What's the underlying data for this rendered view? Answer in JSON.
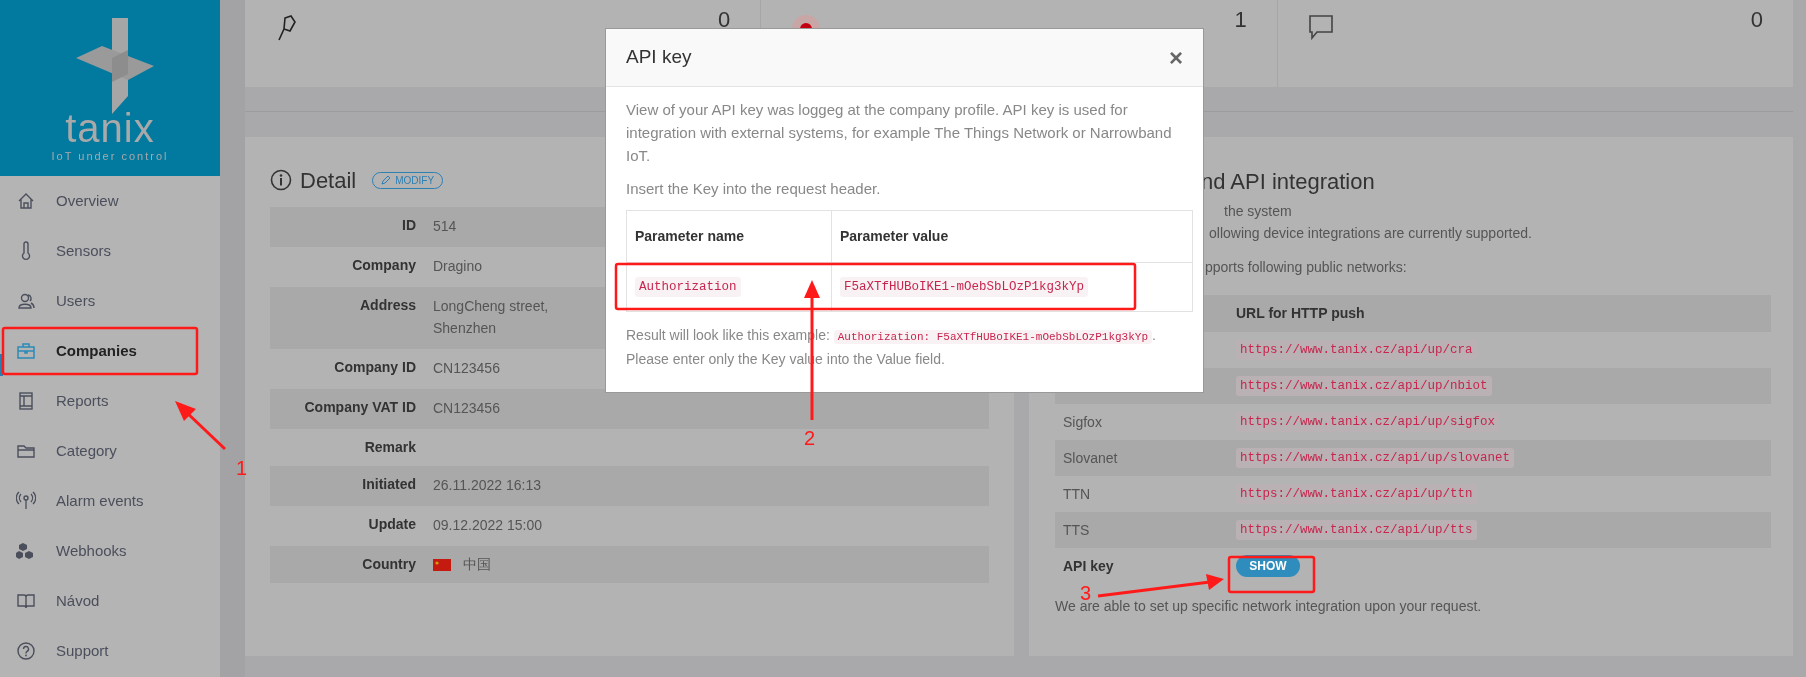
{
  "sidebar": {
    "logo": {
      "name": "tanix",
      "tagline": "IoT under control"
    },
    "items": [
      {
        "label": "Overview",
        "selected": false
      },
      {
        "label": "Sensors",
        "selected": false
      },
      {
        "label": "Users",
        "selected": false
      },
      {
        "label": "Companies",
        "selected": true
      },
      {
        "label": "Reports",
        "selected": false
      },
      {
        "label": "Category",
        "selected": false
      },
      {
        "label": "Alarm events",
        "selected": false
      },
      {
        "label": "Webhooks",
        "selected": false
      },
      {
        "label": "Návod",
        "selected": false
      },
      {
        "label": "Support",
        "selected": false
      }
    ]
  },
  "stats": [
    {
      "value": "0"
    },
    {
      "value": "1"
    },
    {
      "value": "0"
    }
  ],
  "detail": {
    "title": "Detail",
    "modify_button": "MODIFY",
    "rows": [
      {
        "kind": "text",
        "label": "ID",
        "value": "514"
      },
      {
        "kind": "text",
        "label": "Company",
        "value": "Dragino"
      },
      {
        "kind": "text",
        "label": "Address",
        "value": "LongCheng street,\nShenzhen"
      },
      {
        "kind": "text",
        "label": "Company ID",
        "value": "CN123456"
      },
      {
        "kind": "text",
        "label": "Company VAT ID",
        "value": "CN123456"
      },
      {
        "kind": "text",
        "label": "Remark"
      },
      {
        "kind": "text",
        "label": "Initiated",
        "value": "26.11.2022 16:13"
      },
      {
        "kind": "text",
        "label": "Update",
        "value": "09.12.2022 15:00"
      },
      {
        "kind": "country",
        "label": "Country",
        "value": "中国"
      }
    ]
  },
  "integration": {
    "title": "nd API integration",
    "lines": [
      "the system",
      "ollowing device integrations are currently supported.",
      "pports following public networks:"
    ],
    "table": {
      "columns": [
        "URL for HTTP push"
      ],
      "rows": [
        {
          "url": "https://www.tanix.cz/api/up/cra"
        },
        {
          "url": "https://www.tanix.cz/api/up/nbiot"
        },
        {
          "network": "Sigfox",
          "url": "https://www.tanix.cz/api/up/sigfox"
        },
        {
          "network": "Slovanet",
          "url": "https://www.tanix.cz/api/up/slovanet"
        },
        {
          "network": "TTN",
          "url": "https://www.tanix.cz/api/up/ttn"
        },
        {
          "network": "TTS",
          "url": "https://www.tanix.cz/api/up/tts"
        }
      ]
    },
    "api_key_label": "API key",
    "show_button": "SHOW",
    "footer": "We are able to set up specific network integration upon your request."
  },
  "modal": {
    "title": "API key",
    "close": "×",
    "paragraphs": [
      "View of your API key was loggeg at the company profile. API key is used for integration with external systems, for example The Things Network or Narrowband IoT.",
      "Insert the Key into the request header."
    ],
    "table": {
      "columns": [
        "Parameter name",
        "Parameter value"
      ],
      "rows": [
        [
          "Authorization",
          "F5aXTfHUBoIKE1-mOebSbLOzP1kg3kYp"
        ]
      ]
    },
    "result": {
      "prefix": "Result will look like this example: ",
      "code": "Authorization: F5aXTfHUBoIKE1-mOebSbLOzP1kg3kYp",
      "suffix": ". Please enter only the Key value into the Value field."
    }
  },
  "annotations": [
    {
      "label": "1"
    },
    {
      "label": "2"
    },
    {
      "label": "3"
    }
  ]
}
